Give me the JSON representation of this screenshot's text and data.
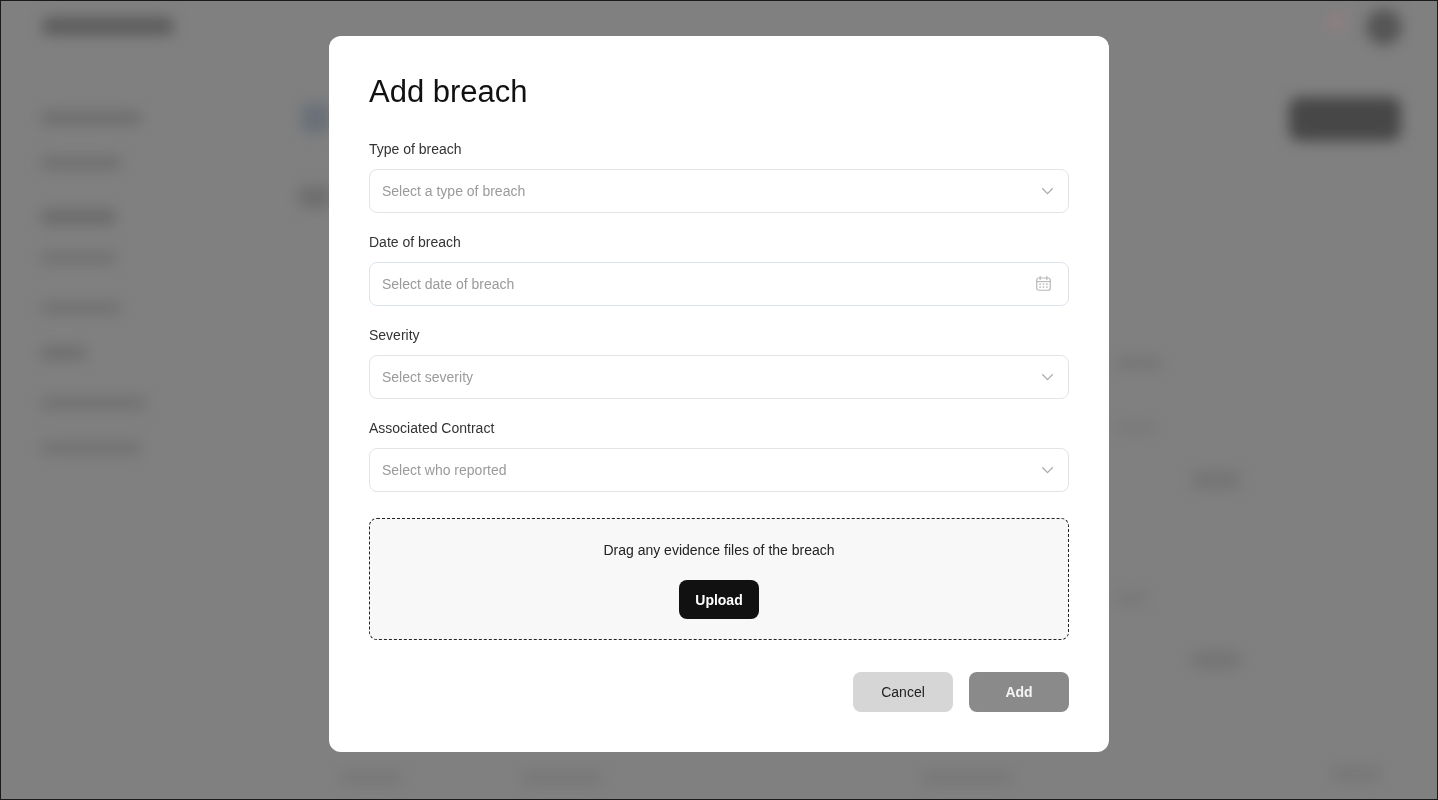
{
  "dialog": {
    "title": "Add breach",
    "fields": [
      {
        "kind": "select",
        "label": "Type of breach",
        "placeholder": "Select a type of breach"
      },
      {
        "kind": "date",
        "label": "Date of breach",
        "placeholder": "Select date of breach"
      },
      {
        "kind": "select",
        "label": "Severity",
        "placeholder": "Select severity"
      },
      {
        "kind": "select",
        "label": "Associated Contract",
        "placeholder": "Select who reported"
      }
    ],
    "dropzone": {
      "text": "Drag any evidence files of the breach",
      "button": "Upload"
    },
    "buttons": [
      {
        "kind": "secondary",
        "label": "Cancel",
        "disabled": false
      },
      {
        "kind": "primary",
        "label": "Add",
        "disabled": true
      }
    ]
  }
}
